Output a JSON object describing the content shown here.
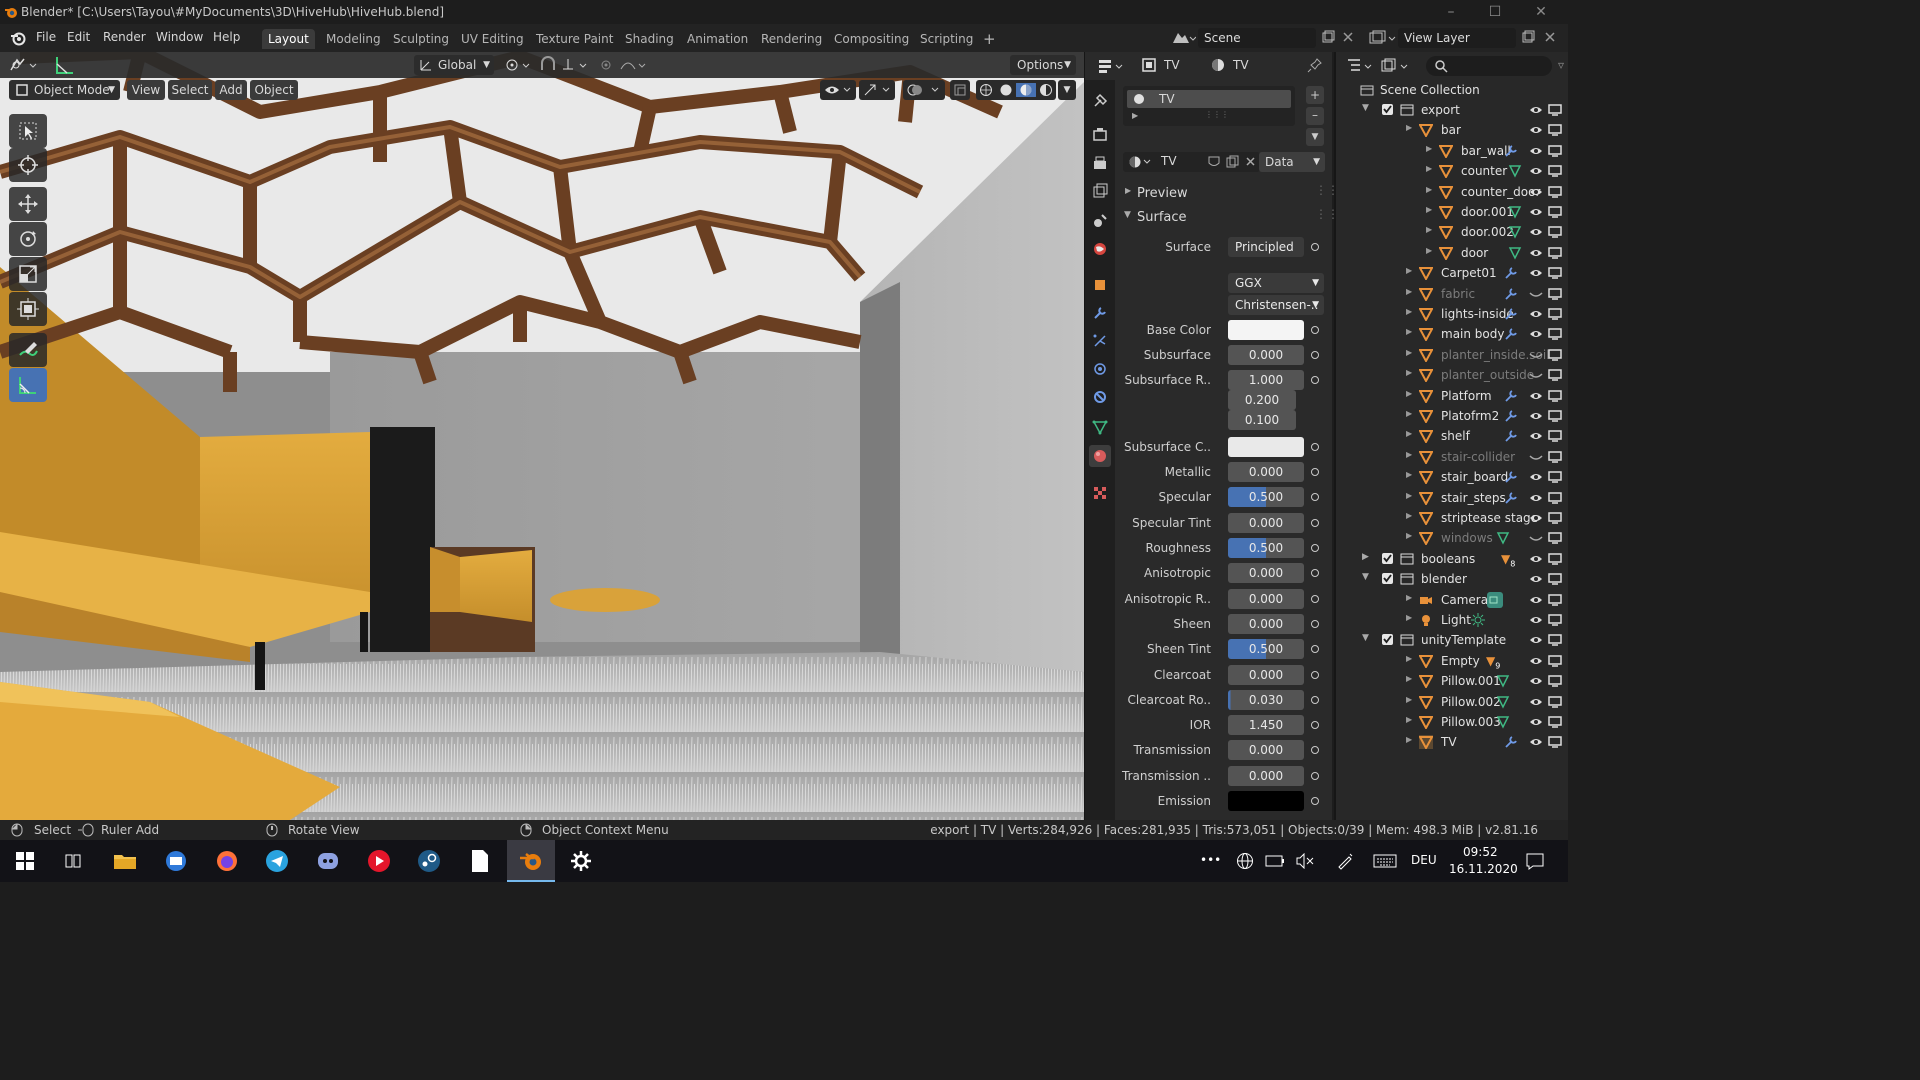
{
  "window": {
    "title": "Blender* [C:\\Users\\Tayou\\#MyDocuments\\3D\\HiveHub\\HiveHub.blend]",
    "minimize": "–",
    "maximize": "☐",
    "close": "✕"
  },
  "menu": [
    "File",
    "Edit",
    "Render",
    "Window",
    "Help"
  ],
  "workspaces": [
    "Layout",
    "Modeling",
    "Sculpting",
    "UV Editing",
    "Texture Paint",
    "Shading",
    "Animation",
    "Rendering",
    "Compositing",
    "Scripting"
  ],
  "active_workspace": "Layout",
  "add_workspace": "+",
  "scene": "Scene",
  "view_layer": "View Layer",
  "viewport": {
    "transform_orientation": "Global",
    "options": "Options",
    "mode": "Object Mode",
    "menus": [
      "View",
      "Select",
      "Add",
      "Object"
    ]
  },
  "properties": {
    "header_object": "TV",
    "header_material": "TV",
    "slot_name": "TV",
    "material_name": "TV",
    "link_mode": "Data",
    "panels": {
      "preview": "Preview",
      "surface": "Surface"
    },
    "surface_label": "Surface",
    "surface_shader": "Principled B..",
    "distribution": "GGX",
    "subsurface_method": "Christensen-..",
    "rows": [
      {
        "label": "Base Color",
        "value": "",
        "kind": "color-white"
      },
      {
        "label": "Subsurface",
        "value": "0.000",
        "kind": "num"
      },
      {
        "label": "Subsurface R..",
        "value": "1.000",
        "kind": "num"
      },
      {
        "label": "",
        "value": "0.200",
        "kind": "num"
      },
      {
        "label": "",
        "value": "0.100",
        "kind": "num"
      },
      {
        "label": "Subsurface C..",
        "value": "",
        "kind": "color-light"
      },
      {
        "label": "Metallic",
        "value": "0.000",
        "kind": "num"
      },
      {
        "label": "Specular",
        "value": "0.500",
        "kind": "factor"
      },
      {
        "label": "Specular Tint",
        "value": "0.000",
        "kind": "num"
      },
      {
        "label": "Roughness",
        "value": "0.500",
        "kind": "factor"
      },
      {
        "label": "Anisotropic",
        "value": "0.000",
        "kind": "num"
      },
      {
        "label": "Anisotropic R..",
        "value": "0.000",
        "kind": "num"
      },
      {
        "label": "Sheen",
        "value": "0.000",
        "kind": "num"
      },
      {
        "label": "Sheen Tint",
        "value": "0.500",
        "kind": "factor"
      },
      {
        "label": "Clearcoat",
        "value": "0.000",
        "kind": "num"
      },
      {
        "label": "Clearcoat Ro..",
        "value": "0.030",
        "kind": "tiny"
      },
      {
        "label": "IOR",
        "value": "1.450",
        "kind": "num"
      },
      {
        "label": "Transmission",
        "value": "0.000",
        "kind": "num"
      },
      {
        "label": "Transmission ..",
        "value": "0.000",
        "kind": "num"
      },
      {
        "label": "Emission",
        "value": "",
        "kind": "color-black"
      }
    ]
  },
  "outliner": {
    "root": "Scene Collection",
    "items": [
      {
        "name": "export",
        "type": "collection",
        "depth": 0,
        "expanded": true
      },
      {
        "name": "bar",
        "type": "mesh",
        "depth": 1,
        "expanded": true
      },
      {
        "name": "bar_wall",
        "type": "mesh",
        "depth": 2,
        "extra": "wrench"
      },
      {
        "name": "counter",
        "type": "mesh",
        "depth": 2,
        "extra": "data"
      },
      {
        "name": "counter_door",
        "type": "mesh",
        "depth": 2,
        "extra": ""
      },
      {
        "name": "door.001",
        "type": "mesh",
        "depth": 2,
        "extra": "data"
      },
      {
        "name": "door.002",
        "type": "mesh",
        "depth": 2,
        "extra": "data"
      },
      {
        "name": "door",
        "type": "mesh",
        "depth": 2,
        "extra": "data"
      },
      {
        "name": "Carpet01",
        "type": "mesh",
        "depth": 1,
        "extra": "wrench"
      },
      {
        "name": "fabric",
        "type": "mesh",
        "depth": 1,
        "extra": "wrench",
        "dim": true
      },
      {
        "name": "lights-inside",
        "type": "mesh",
        "depth": 1,
        "extra": "wrench"
      },
      {
        "name": "main body",
        "type": "mesh",
        "depth": 1,
        "extra": "wrench"
      },
      {
        "name": "planter_inside.soil",
        "type": "mesh",
        "depth": 1,
        "extra": "",
        "dim": true
      },
      {
        "name": "planter_outside",
        "type": "mesh",
        "depth": 1,
        "extra": "",
        "dim": true
      },
      {
        "name": "Platform",
        "type": "mesh",
        "depth": 1,
        "extra": "wrench"
      },
      {
        "name": "Platofrm2",
        "type": "mesh",
        "depth": 1,
        "extra": "wrench"
      },
      {
        "name": "shelf",
        "type": "mesh",
        "depth": 1,
        "extra": "wrench"
      },
      {
        "name": "stair-collider",
        "type": "mesh",
        "depth": 1,
        "extra": "",
        "dim": true
      },
      {
        "name": "stair_board",
        "type": "mesh",
        "depth": 1,
        "extra": "wrench"
      },
      {
        "name": "stair_steps",
        "type": "mesh",
        "depth": 1,
        "extra": "wrench"
      },
      {
        "name": "striptease stage",
        "type": "mesh",
        "depth": 1,
        "extra": ""
      },
      {
        "name": "windows",
        "type": "mesh",
        "depth": 1,
        "extra": "data",
        "dim": true
      },
      {
        "name": "booleans",
        "type": "collection",
        "depth": 0,
        "expanded": false,
        "badge": "8"
      },
      {
        "name": "blender",
        "type": "collection",
        "depth": 0,
        "expanded": true
      },
      {
        "name": "Camera",
        "type": "camera",
        "depth": 1,
        "extra": ""
      },
      {
        "name": "Light",
        "type": "light",
        "depth": 1,
        "extra": ""
      },
      {
        "name": "unityTemplate",
        "type": "collection",
        "depth": 0,
        "expanded": true
      },
      {
        "name": "Empty",
        "type": "empty",
        "depth": 1,
        "extra": "",
        "badge": "9"
      },
      {
        "name": "Pillow.001",
        "type": "mesh",
        "depth": 1,
        "extra": "data"
      },
      {
        "name": "Pillow.002",
        "type": "mesh",
        "depth": 1,
        "extra": "data"
      },
      {
        "name": "Pillow.003",
        "type": "mesh",
        "depth": 1,
        "extra": "data"
      },
      {
        "name": "TV",
        "type": "mesh",
        "depth": 1,
        "extra": "wrench",
        "selected": true
      }
    ]
  },
  "status": {
    "select": "Select",
    "ruler_add": "Ruler Add",
    "rotate_view": "Rotate View",
    "context_menu": "Object Context Menu",
    "stats": "export | TV | Verts:284,926 | Faces:281,935 | Tris:573,051 | Objects:0/39 | Mem: 498.3 MiB | v2.81.16"
  },
  "taskbar": {
    "lang": "DEU",
    "time": "09:52",
    "date": "16.11.2020",
    "more": "•••"
  },
  "colors": {
    "accent": "#4772b3",
    "mesh_icon": "#e8913a",
    "data_icon": "#3fb883",
    "wrench_icon": "#6f9ae6"
  }
}
